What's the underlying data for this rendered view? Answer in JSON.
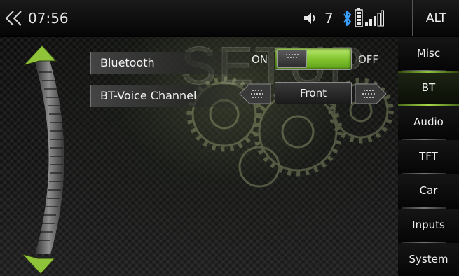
{
  "status_bar": {
    "clock": "07:56",
    "volume_level": "7",
    "alt_label": "ALT"
  },
  "header": {
    "watermark": "SETUP"
  },
  "settings": [
    {
      "label": "Bluetooth",
      "on_label": "ON",
      "off_label": "OFF",
      "state": "off"
    },
    {
      "label": "BT-Voice Channel",
      "value": "Front"
    }
  ],
  "tabs": [
    {
      "label": "Misc",
      "active": false
    },
    {
      "label": "BT",
      "active": true
    },
    {
      "label": "Audio",
      "active": false
    },
    {
      "label": "TFT",
      "active": false
    },
    {
      "label": "Car",
      "active": false
    },
    {
      "label": "Inputs",
      "active": false
    },
    {
      "label": "System",
      "active": false
    }
  ],
  "colors": {
    "accent_green": "#8fc43a",
    "bluetooth_blue": "#3aa0ff"
  },
  "icons": {
    "back": "double-chevron-left-icon",
    "volume": "speaker-icon",
    "bluetooth": "bluetooth-icon",
    "battery": "battery-icon",
    "signal": "signal-bars-icon"
  }
}
